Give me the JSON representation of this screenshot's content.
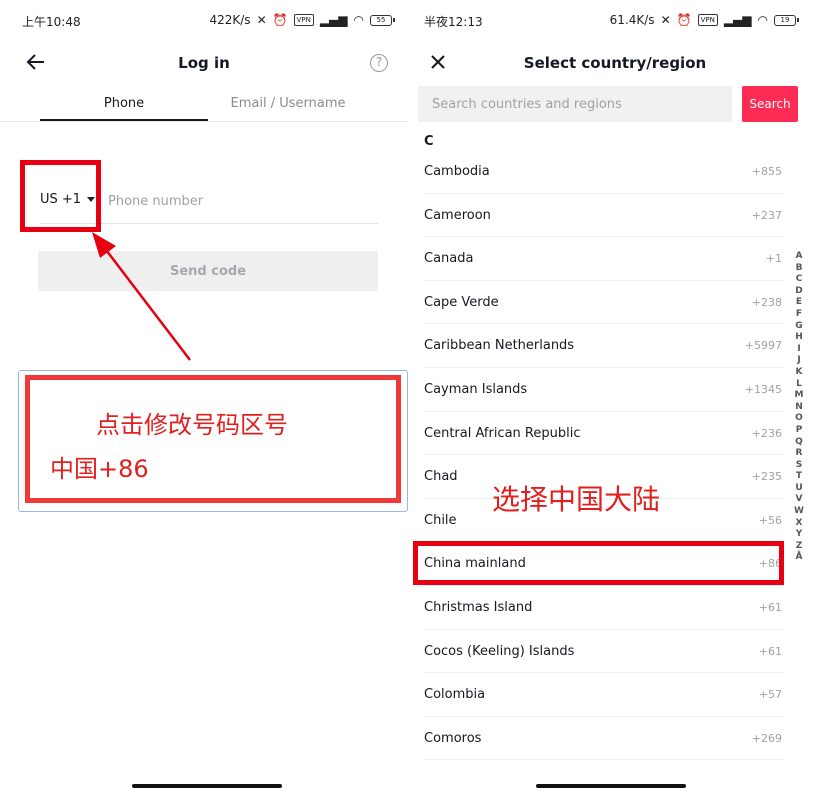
{
  "left": {
    "status": {
      "time": "上午10:48",
      "speed": "422K/s",
      "battery": "55"
    },
    "header": {
      "title": "Log in",
      "help": "?"
    },
    "tabs": [
      {
        "label": "Phone",
        "active": true
      },
      {
        "label": "Email / Username",
        "active": false
      }
    ],
    "phone": {
      "country_code": "US +1",
      "placeholder": "Phone number"
    },
    "send_code_label": "Send code",
    "annotation": {
      "line1": "点击修改号码区号",
      "line2": "中国+86"
    }
  },
  "right": {
    "status": {
      "time": "半夜12:13",
      "speed": "61.4K/s",
      "battery": "19"
    },
    "header": {
      "title": "Select country/region"
    },
    "search": {
      "placeholder": "Search countries and regions",
      "button_label": "Search"
    },
    "section_letter": "C",
    "countries": [
      {
        "name": "Cambodia",
        "code": "+855"
      },
      {
        "name": "Cameroon",
        "code": "+237"
      },
      {
        "name": "Canada",
        "code": "+1"
      },
      {
        "name": "Cape Verde",
        "code": "+238"
      },
      {
        "name": "Caribbean Netherlands",
        "code": "+5997"
      },
      {
        "name": "Cayman Islands",
        "code": "+1345"
      },
      {
        "name": "Central African Republic",
        "code": "+236"
      },
      {
        "name": "Chad",
        "code": "+235"
      },
      {
        "name": "Chile",
        "code": "+56"
      },
      {
        "name": "China mainland",
        "code": "+86"
      },
      {
        "name": "Christmas Island",
        "code": "+61"
      },
      {
        "name": "Cocos (Keeling) Islands",
        "code": "+61"
      },
      {
        "name": "Colombia",
        "code": "+57"
      },
      {
        "name": "Comoros",
        "code": "+269"
      }
    ],
    "alphabet": [
      "A",
      "B",
      "C",
      "D",
      "E",
      "F",
      "G",
      "H",
      "I",
      "J",
      "K",
      "L",
      "M",
      "N",
      "O",
      "P",
      "Q",
      "R",
      "S",
      "T",
      "U",
      "V",
      "W",
      "X",
      "Y",
      "Z",
      "Å"
    ],
    "annotation": "选择中国大陆"
  },
  "colors": {
    "accent": "#fe2c55",
    "highlight": "#e60012",
    "annotation_text": "#e0201e"
  }
}
